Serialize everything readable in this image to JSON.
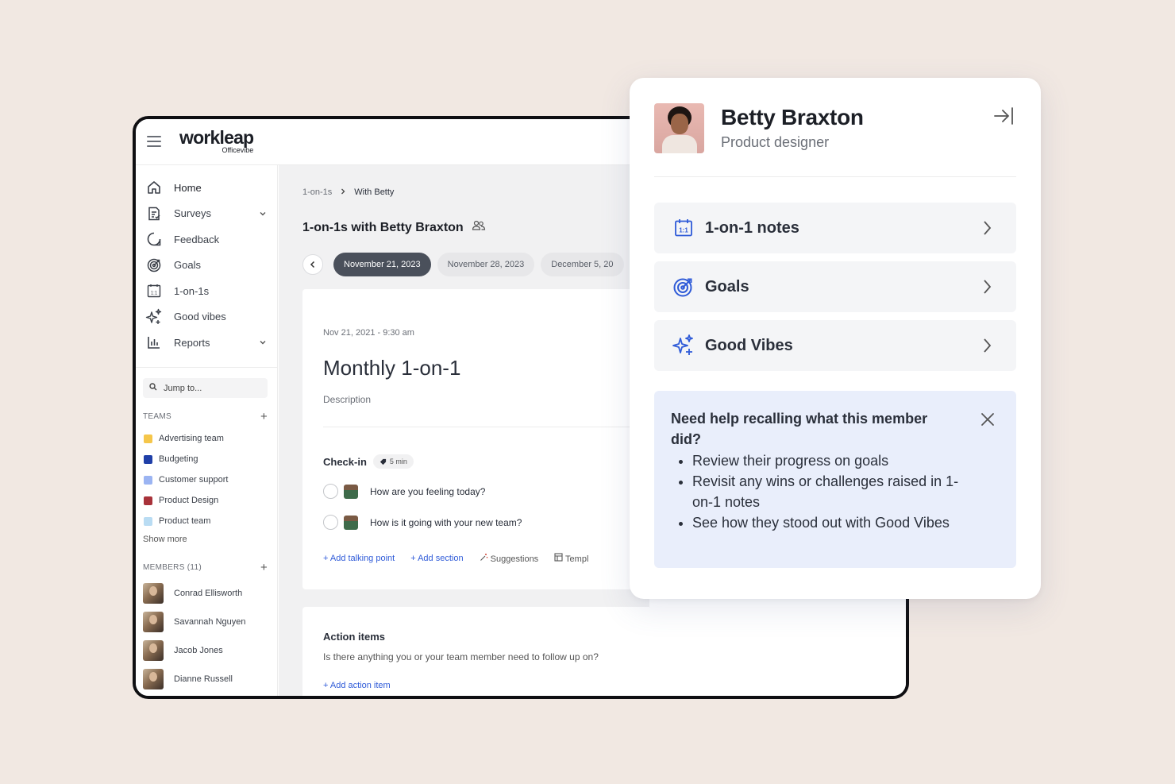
{
  "app": {
    "brand": "workleap",
    "brand_sub": "Officevibe"
  },
  "sidebar": {
    "nav": [
      {
        "label": "Home",
        "icon": "home-icon"
      },
      {
        "label": "Surveys",
        "icon": "surveys-icon",
        "expandable": true
      },
      {
        "label": "Feedback",
        "icon": "feedback-icon"
      },
      {
        "label": "Goals",
        "icon": "goals-icon"
      },
      {
        "label": "1-on-1s",
        "icon": "calendar-icon"
      },
      {
        "label": "Good vibes",
        "icon": "sparkle-icon"
      },
      {
        "label": "Reports",
        "icon": "reports-icon",
        "expandable": true
      }
    ],
    "search_placeholder": "Jump to...",
    "teams_heading": "TEAMS",
    "teams": [
      {
        "name": "Advertising team",
        "color": "#f5c64a"
      },
      {
        "name": "Budgeting",
        "color": "#1f3fa8"
      },
      {
        "name": "Customer support",
        "color": "#9bb4f2"
      },
      {
        "name": "Product Design",
        "color": "#a8323a"
      },
      {
        "name": "Product team",
        "color": "#b9dcf3"
      }
    ],
    "show_more": "Show more",
    "members_heading": "MEMBERS (11)",
    "members": [
      "Conrad Ellisworth",
      "Savannah Nguyen",
      "Jacob Jones",
      "Dianne Russell"
    ]
  },
  "main": {
    "breadcrumb": [
      "1-on-1s",
      "With Betty"
    ],
    "title": "1-on-1s with Betty Braxton",
    "dates": [
      "November 21, 2023",
      "November 28, 2023",
      "December 5, 20"
    ],
    "meeting": {
      "datetime": "Nov 21, 2021 - 9:30 am",
      "title": "Monthly 1-on-1",
      "description_placeholder": "Description",
      "checkin_label": "Check-in",
      "checkin_duration": "5 min",
      "questions": [
        "How are you feeling today?",
        "How is it going with your new team?"
      ],
      "actions": [
        "+ Add talking point",
        "+ Add section",
        "Suggestions",
        "Templ"
      ]
    },
    "action_items": {
      "title": "Action items",
      "prompt": "Is there anything you or your team member need to follow up on?",
      "add_label": "+ Add action item"
    }
  },
  "panel": {
    "name": "Betty Braxton",
    "role": "Product designer",
    "rows": [
      {
        "label": "1-on-1 notes",
        "icon": "calendar-icon"
      },
      {
        "label": "Goals",
        "icon": "goals-icon"
      },
      {
        "label": "Good Vibes",
        "icon": "sparkle-icon"
      }
    ],
    "help": {
      "title": "Need help recalling what this member did?",
      "bullets": [
        "Review their progress on goals",
        "Revisit any wins or challenges raised in 1-on-1 notes",
        "See how they stood out with Good Vibes"
      ]
    }
  },
  "colors": {
    "accent": "#2f5bd8",
    "background": "#f1e8e2",
    "help_bg": "#e9eefb",
    "active_chip": "#4a505b"
  }
}
